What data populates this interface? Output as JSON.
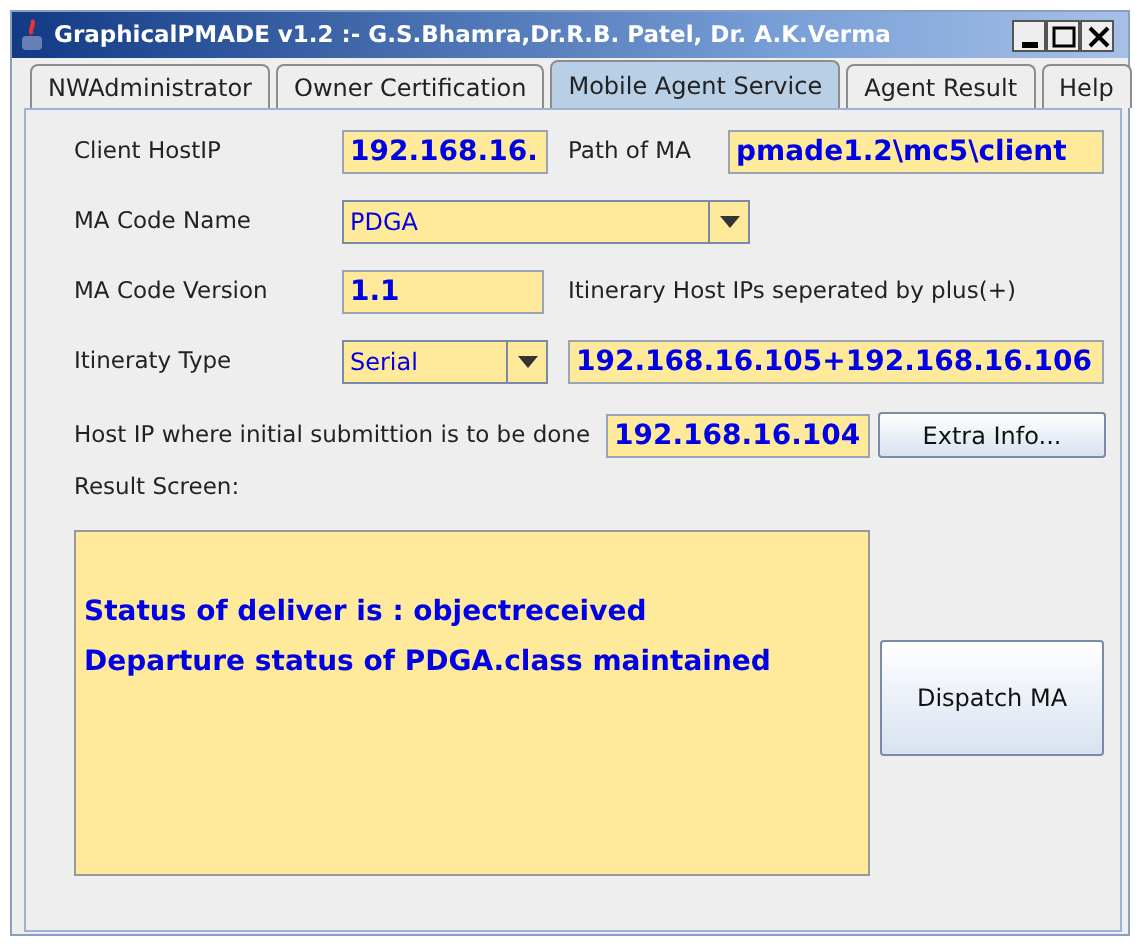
{
  "window": {
    "title": "GraphicalPMADE v1.2 :- G.S.Bhamra,Dr.R.B. Patel, Dr. A.K.Verma"
  },
  "tabs": [
    {
      "label": "NWAdministrator",
      "selected": false
    },
    {
      "label": "Owner Certification",
      "selected": false
    },
    {
      "label": "Mobile Agent Service",
      "selected": true
    },
    {
      "label": "Agent Result",
      "selected": false
    },
    {
      "label": "Help",
      "selected": false
    }
  ],
  "form": {
    "client_host_ip": {
      "label": "Client HostIP",
      "value": "192.168.16."
    },
    "path_of_ma": {
      "label": "Path of MA",
      "value": "pmade1.2\\mc5\\client"
    },
    "ma_code_name": {
      "label": "MA Code Name",
      "value": "PDGA"
    },
    "ma_code_version": {
      "label": "MA Code Version",
      "value": "1.1"
    },
    "itinerary_hint": "Itinerary Host IPs seperated by plus(+)",
    "itineraty_type": {
      "label": "Itineraty Type",
      "value": "Serial"
    },
    "itinerary_host_ips": {
      "value": "192.168.16.105+192.168.16.106"
    },
    "initial_host_ip": {
      "label": "Host IP where initial submittion is to be done",
      "value": "192.168.16.104"
    },
    "extra_info_button": "Extra Info...",
    "result_label": "Result Screen:",
    "result_lines": [
      "Status of deliver is : objectreceived",
      "Departure status of PDGA.class maintained"
    ],
    "dispatch_button": "Dispatch MA"
  }
}
